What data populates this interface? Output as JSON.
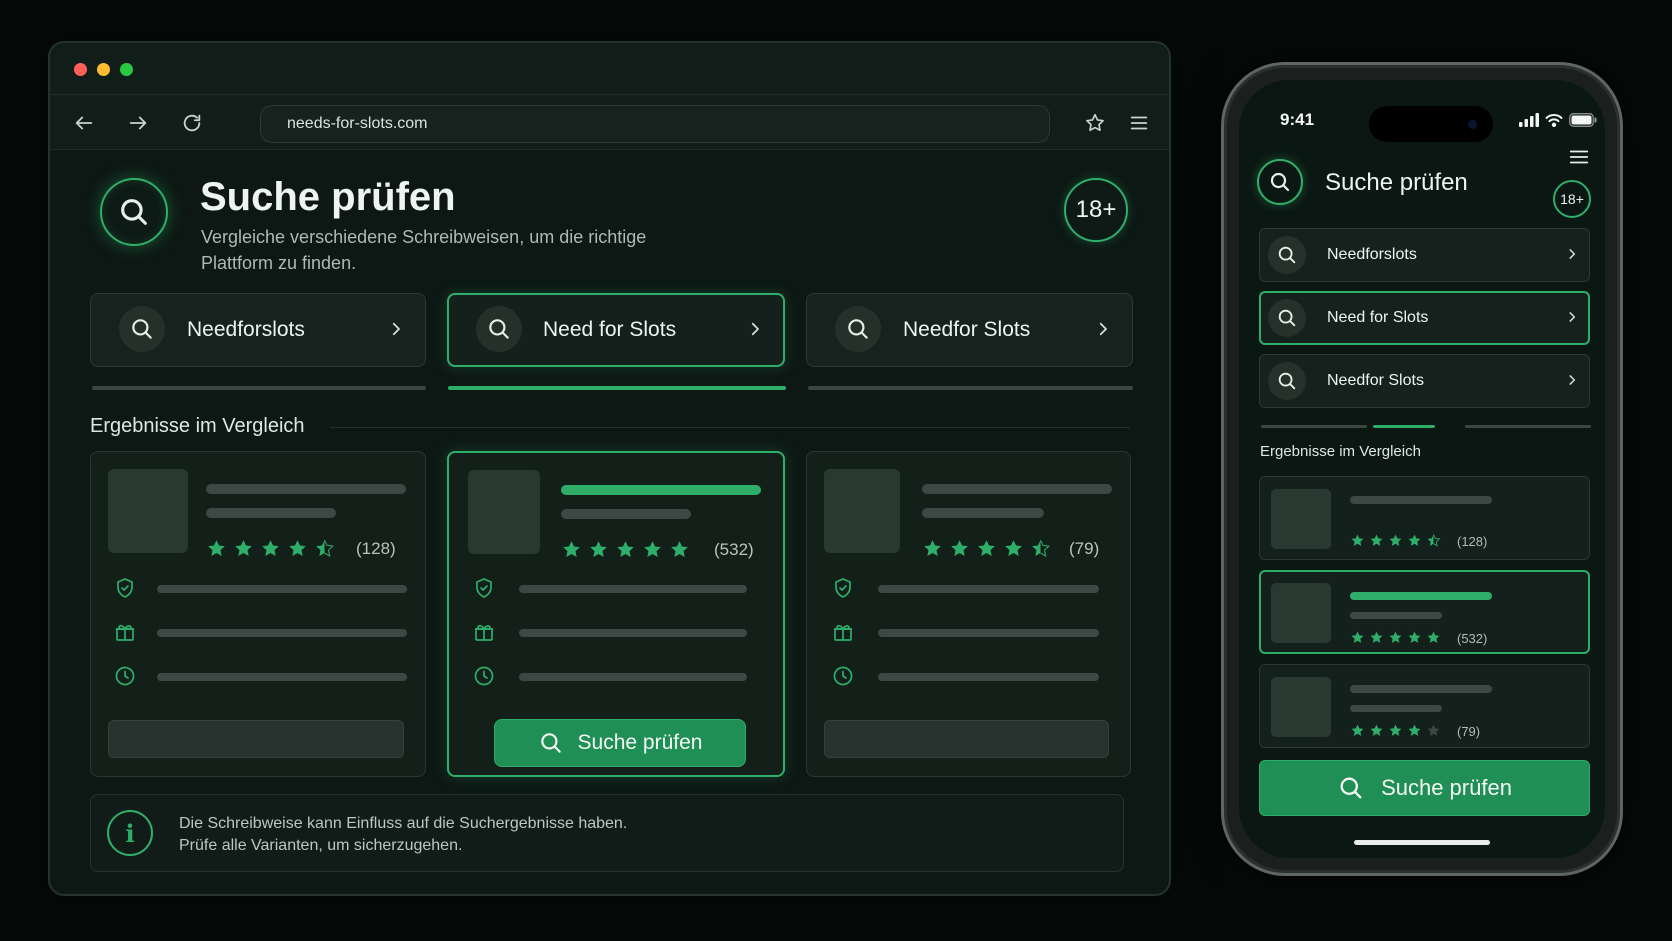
{
  "browser": {
    "url": "needs-for-slots.com",
    "header": {
      "title": "Suche prüfen",
      "subtitle": "Vergleiche verschiedene Schreibweisen, um die richtige Plattform zu finden.",
      "age_badge": "18+"
    },
    "search_tabs": [
      {
        "label": "Needforslots",
        "active": false
      },
      {
        "label": "Need for Slots",
        "active": true
      },
      {
        "label": "Needfor Slots",
        "active": false
      }
    ],
    "section_title": "Ergebnisse im Vergleich",
    "results": [
      {
        "rating": 4.5,
        "count": "(128)",
        "active": false
      },
      {
        "rating": 5,
        "count": "(532)",
        "active": true,
        "button_label": "Suche prüfen"
      },
      {
        "rating": 4.5,
        "count": "(79)",
        "active": false
      }
    ],
    "info": {
      "icon": "i",
      "line1": "Die Schreibweise kann Einfluss auf die Suchergebnisse haben.",
      "line2": "Prüfe alle Varianten, um sicherzugehen."
    }
  },
  "phone": {
    "time": "9:41",
    "header": {
      "title": "Suche prüfen",
      "age_badge": "18+"
    },
    "search_tabs": [
      {
        "label": "Needforslots",
        "active": false
      },
      {
        "label": "Need for Slots",
        "active": true
      },
      {
        "label": "Needfor Slots",
        "active": false
      }
    ],
    "section_title": "Ergebnisse im Vergleich",
    "results": [
      {
        "rating": 4.5,
        "count": "(128)"
      },
      {
        "rating": 5,
        "count": "(532)"
      },
      {
        "rating": 4,
        "count": "(79)"
      }
    ],
    "button_label": "Suche prüfen"
  },
  "colors": {
    "accent": "#2fae6a",
    "button": "#1f8f55",
    "background": "#050a08",
    "panel": "#0d1814",
    "traffic_red": "#ff5f57",
    "traffic_yellow": "#febc2e",
    "traffic_green": "#28c840"
  },
  "icons": [
    "back-arrow-icon",
    "forward-arrow-icon",
    "reload-icon",
    "star-bookmark-icon",
    "hamburger-menu-icon",
    "search-icon",
    "chevron-right-icon",
    "shield-check-icon",
    "gift-icon",
    "clock-icon",
    "info-icon",
    "signal-icon",
    "wifi-icon",
    "battery-icon"
  ]
}
